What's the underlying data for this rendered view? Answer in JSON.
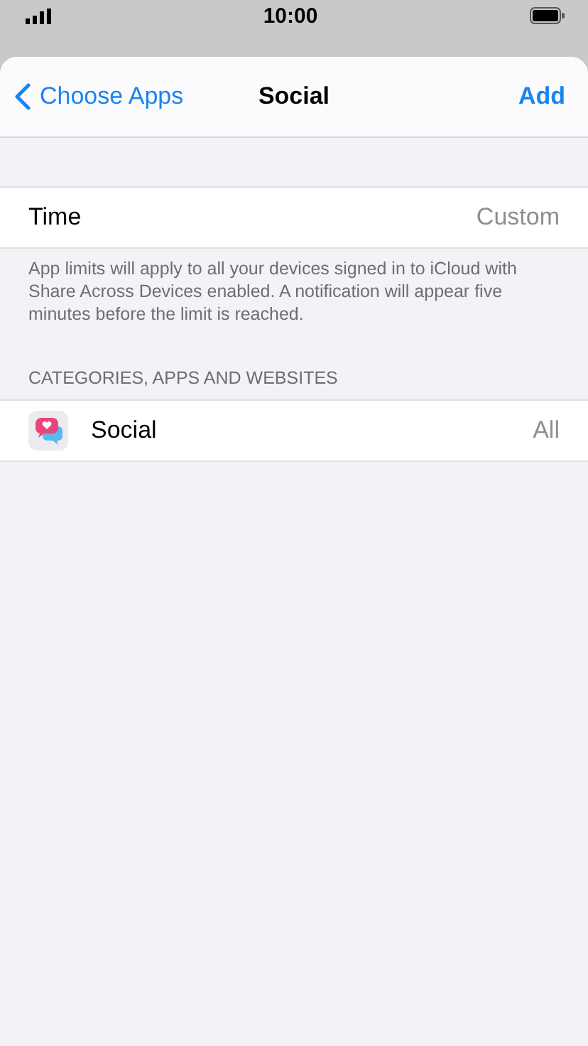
{
  "status_bar": {
    "time": "10:00"
  },
  "nav": {
    "back": "Choose Apps",
    "title": "Social",
    "action": "Add"
  },
  "time_row": {
    "label": "Time",
    "value": "Custom"
  },
  "footer": "App limits will apply to all your devices signed in to iCloud with Share Across Devices enabled. A notification will appear five minutes before the limit is reached.",
  "section_header": "CATEGORIES, APPS AND WEBSITES",
  "categories": [
    {
      "label": "Social",
      "value": "All"
    }
  ]
}
